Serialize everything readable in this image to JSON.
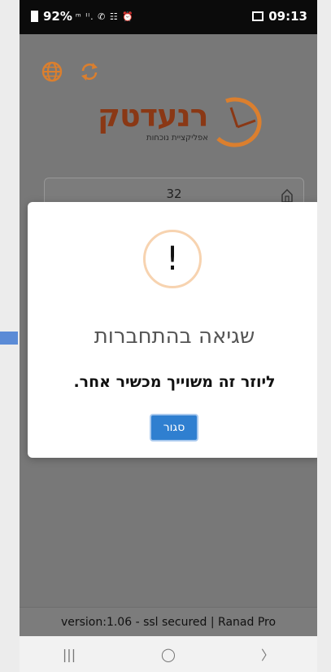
{
  "status_bar": {
    "battery": "92%",
    "indicators": "ᵐ ᴵˡ. ✆ ☷ ⏰",
    "time": "09:13"
  },
  "app": {
    "logo_name": "רנעדטק",
    "logo_sub": "אפליקציית נוכחות"
  },
  "login": {
    "user_value": "32"
  },
  "dialog": {
    "icon": "!",
    "title": "שגיאה בהתחברות",
    "message": "ליוזר זה משוייך מכשיר אחר.",
    "close_label": "סגור"
  },
  "footer": {
    "version_text": "version:1.06 - ssl secured | Ranad Pro"
  },
  "navbar": {
    "recent": "|||",
    "home": "◯",
    "back": "〉"
  },
  "colors": {
    "accent": "#e0822f",
    "brand": "#8d3a16",
    "button": "#2f7fd0"
  }
}
